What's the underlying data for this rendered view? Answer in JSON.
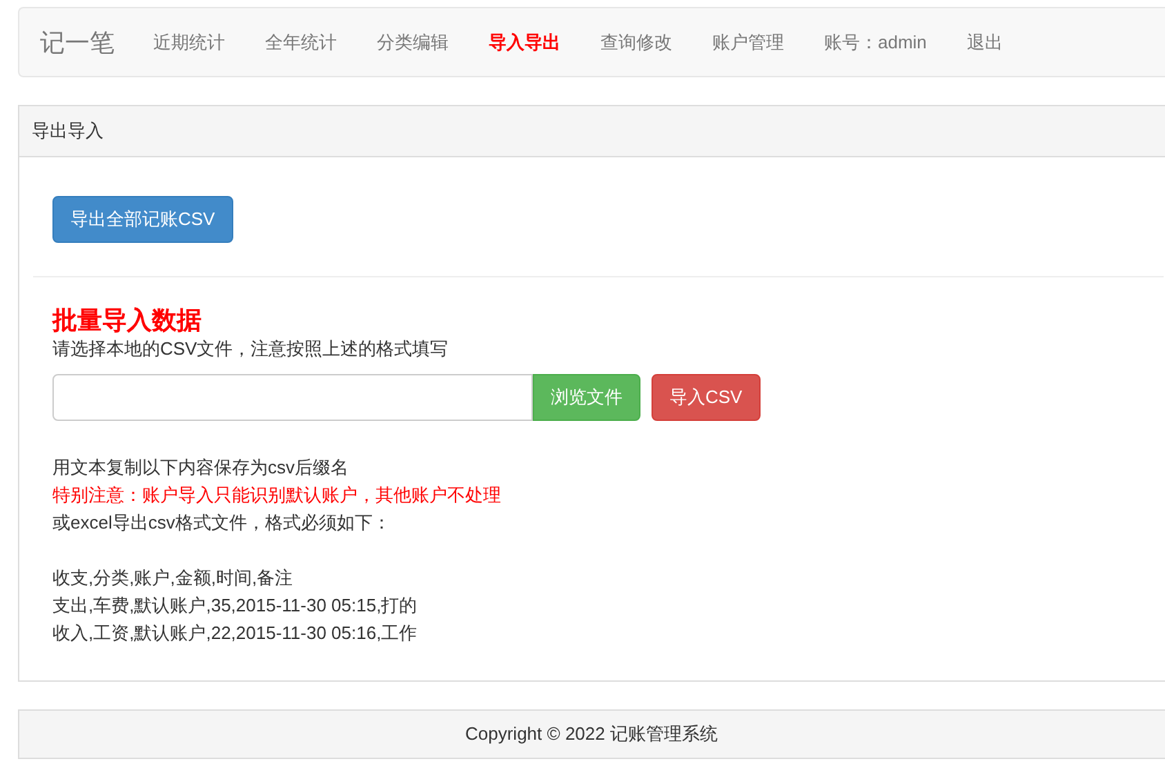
{
  "navbar": {
    "brand": "记一笔",
    "items": [
      {
        "label": "近期统计",
        "selected": false
      },
      {
        "label": "全年统计",
        "selected": false
      },
      {
        "label": "分类编辑",
        "selected": false
      },
      {
        "label": "导入导出",
        "selected": true
      },
      {
        "label": "查询修改",
        "selected": false
      },
      {
        "label": "账户管理",
        "selected": false
      },
      {
        "label": "账号：admin",
        "selected": false
      },
      {
        "label": "退出",
        "selected": false
      }
    ]
  },
  "panel": {
    "heading": "导出导入",
    "export_button": "导出全部记账CSV",
    "import_title": "批量导入数据",
    "import_hint": "请选择本地的CSV文件，注意按照上述的格式填写",
    "browse_button": "浏览文件",
    "import_button": "导入CSV",
    "notes": [
      {
        "text": "用文本复制以下内容保存为csv后缀名",
        "kind": "normal"
      },
      {
        "text": "特别注意：账户导入只能识别默认账户，其他账户不处理",
        "kind": "warning"
      },
      {
        "text": "或excel导出csv格式文件，格式必须如下：",
        "kind": "normal"
      }
    ],
    "format_lines": [
      "收支,分类,账户,金额,时间,备注",
      "支出,车费,默认账户,35,2015-11-30 05:15,打的",
      "收入,工资,默认账户,22,2015-11-30 05:16,工作"
    ]
  },
  "footer": "Copyright © 2022 记账管理系统"
}
